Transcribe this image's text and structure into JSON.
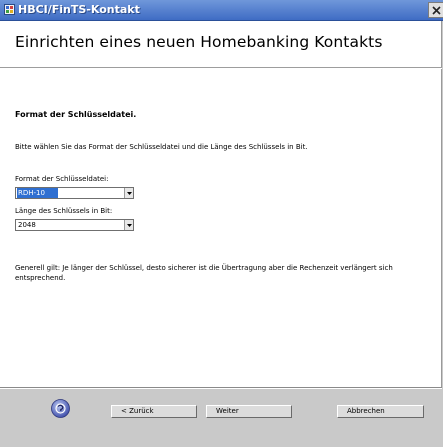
{
  "window": {
    "title": "HBCI/FinTS-Kontakt"
  },
  "header": {
    "title": "Einrichten eines neuen Homebanking Kontakts"
  },
  "section": {
    "heading": "Format der Schlüsseldatei.",
    "instruction": "Bitte wählen Sie das Format der Schlüsseldatei und die Länge des Schlüssels in Bit.",
    "format_label": "Format der Schlüsseldatei:",
    "format_value": "RDH-10",
    "length_label": "Länge des Schlüssels in Bit:",
    "length_value": "2048",
    "note": "Generell gilt: Je länger der Schlüssel, desto sicherer ist die Übertragung aber die Rechenzeit verlängert sich entsprechend."
  },
  "buttons": {
    "back": "< Zurück",
    "next": "Weiter",
    "cancel": "Abbrechen"
  },
  "icons": {
    "app": "app-icon",
    "close": "close-icon",
    "help": "help-icon",
    "dropdown": "chevron-down-icon"
  },
  "colors": {
    "titlebar": "#4a7ad0",
    "selection": "#2f6fd1"
  }
}
